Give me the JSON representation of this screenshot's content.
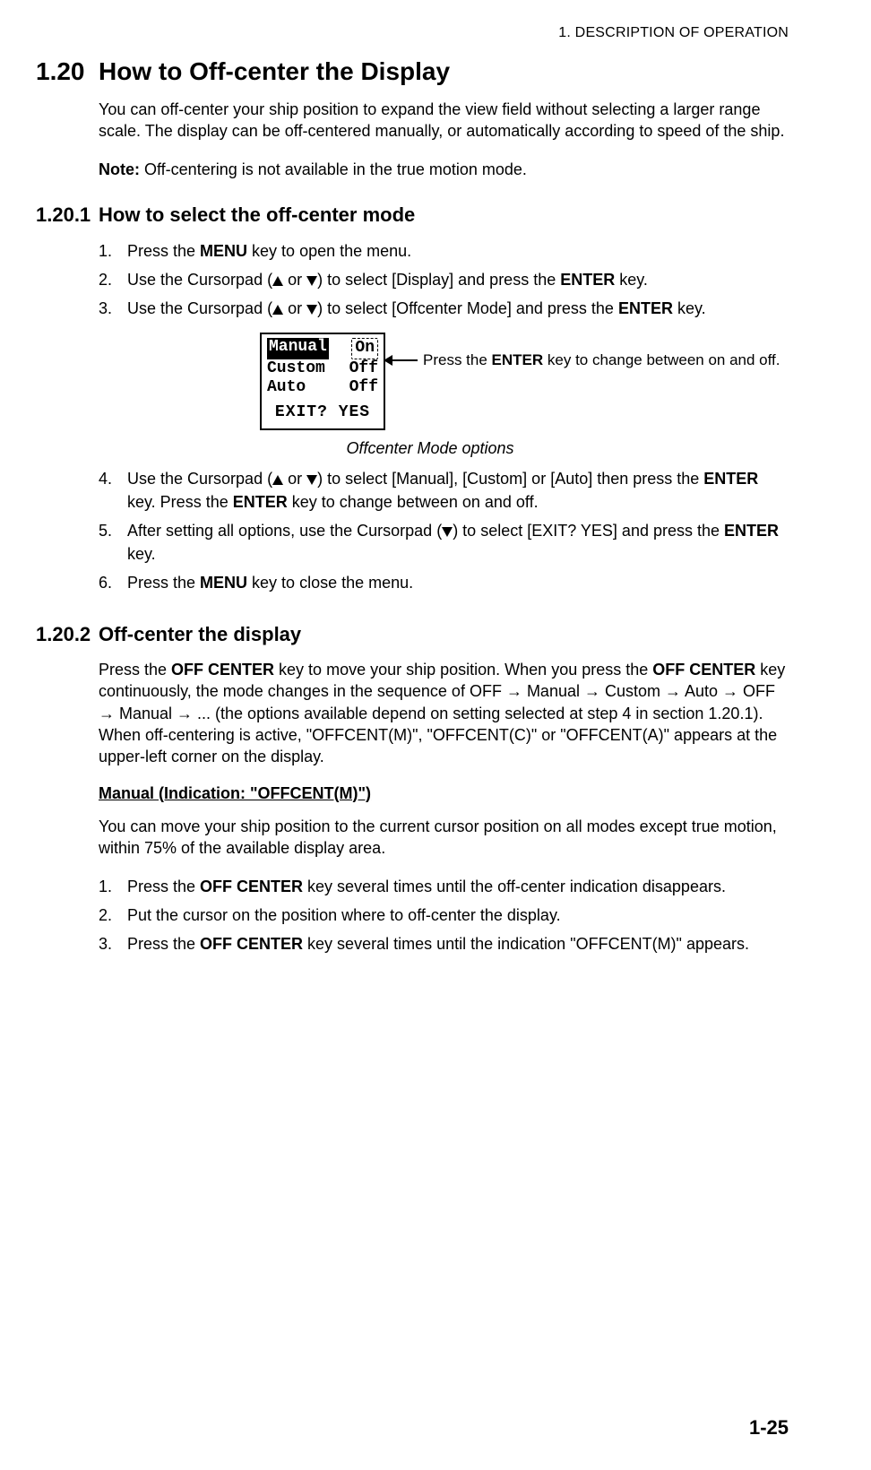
{
  "header": {
    "chapter": "1.  DESCRIPTION OF OPERATION"
  },
  "s120": {
    "num": "1.20",
    "title": "How to Off-center the Display",
    "p1": "You can off-center your ship position to expand the view field without selecting a larger range scale. The display can be off-centered manually, or automatically according to speed of the ship.",
    "note_label": "Note:",
    "note_text": " Off-centering is not available in the true motion mode."
  },
  "s1201": {
    "num": "1.20.1",
    "title": "How to select the off-center mode",
    "steps": {
      "s1a": "Press the ",
      "s1b": "MENU",
      "s1c": " key to open the menu.",
      "s2a": "Use the Cursorpad (",
      "s2b": " or ",
      "s2c": ") to select [Display] and press the ",
      "s2d": "ENTER",
      "s2e": " key.",
      "s3a": "Use the Cursorpad (",
      "s3b": " or ",
      "s3c": ") to select [Offcenter Mode] and press the ",
      "s3d": "ENTER",
      "s3e": " key.",
      "s4a": "Use the Cursorpad (",
      "s4b": " or ",
      "s4c": ") to select [Manual], [Custom] or [Auto] then press the ",
      "s4d": "ENTER",
      "s4e": " key. Press the ",
      "s4f": "ENTER",
      "s4g": " key to change between on and off.",
      "s5a": "After setting all options, use the Cursorpad (",
      "s5b": ") to select [EXIT? YES] and press the ",
      "s5c": "ENTER",
      "s5d": " key.",
      "s6a": "Press the ",
      "s6b": "MENU",
      "s6c": " key to close the menu."
    },
    "menu": {
      "r1_label": "Manual",
      "r1_val": "On",
      "r2_label": "Custom",
      "r2_val": "Off",
      "r3_label": "Auto",
      "r3_val": "Off",
      "exit": "EXIT? YES"
    },
    "callout_a": "Press the ",
    "callout_b": "ENTER",
    "callout_c": " key to change between on and off.",
    "caption": "Offcenter Mode options"
  },
  "s1202": {
    "num": "1.20.2",
    "title": "Off-center the display",
    "p1a": "Press the ",
    "p1b": "OFF CENTER",
    "p1c": " key to move your ship position. When you press the ",
    "p1d": "OFF CENTER",
    "p1e": " key continuously, the mode changes in the sequence of OFF → Manual → Custom → Auto → OFF → Manual → ... (the options available depend on setting selected at step 4 in section 1.20.1). When off-centering is active, \"OFFCENT(M)\", \"OFFCENT(C)\" or \"OFFCENT(A)\" appears at the upper-left corner on the display.",
    "h_manual": "Manual (Indication: \"OFFCENT(M)\")",
    "p2": "You can move your ship position to the current cursor position on all modes except true motion, within 75% of the available display area.",
    "steps": {
      "s1a": "Press the ",
      "s1b": "OFF CENTER",
      "s1c": " key several times until the off-center indication disappears.",
      "s2": "Put the cursor on the position where to off-center the display.",
      "s3a": "Press the ",
      "s3b": "OFF CENTER",
      "s3c": " key several times until the indication \"OFFCENT(M)\" appears."
    }
  },
  "footer": {
    "page": "1-25"
  }
}
